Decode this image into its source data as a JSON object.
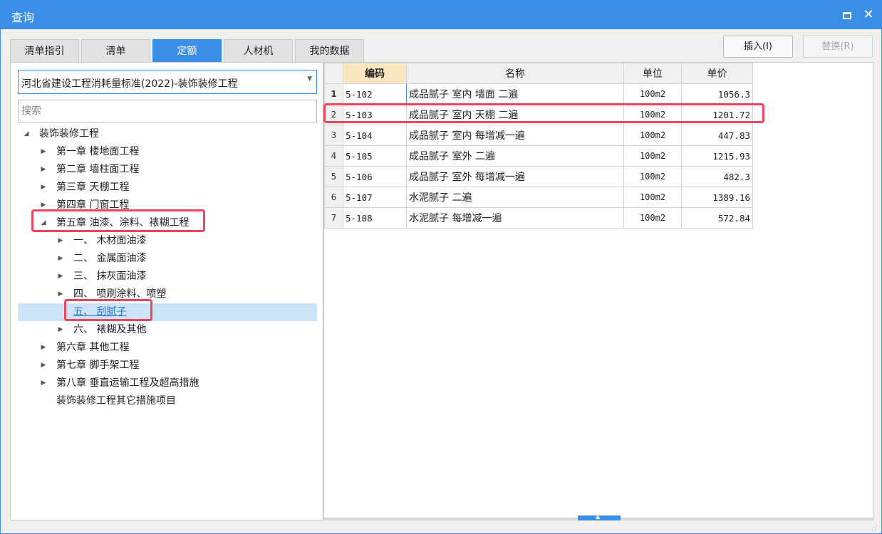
{
  "window": {
    "title": "查询",
    "maximize_label": "",
    "close_label": "✕"
  },
  "tabs": [
    {
      "label": "清单指引"
    },
    {
      "label": "清单"
    },
    {
      "label": "定额"
    },
    {
      "label": "人材机"
    },
    {
      "label": "我的数据"
    }
  ],
  "active_tab": "定额",
  "buttons": {
    "insert_label": "插入(I)",
    "replace_label": "替换(R)"
  },
  "library_select": {
    "value": "河北省建设工程消耗量标准(2022)-装饰装修工程"
  },
  "search": {
    "placeholder": "搜索",
    "value": ""
  },
  "tree": [
    {
      "label": "装饰装修工程",
      "toggle": "◢"
    },
    {
      "label": "第一章 楼地面工程",
      "toggle": "▶"
    },
    {
      "label": "第二章 墙柱面工程",
      "toggle": "▶"
    },
    {
      "label": "第三章 天棚工程",
      "toggle": "▶"
    },
    {
      "label": "第四章 门窗工程",
      "toggle": "▶"
    },
    {
      "label": "第五章 油漆、涂料、裱糊工程",
      "toggle": "◢"
    },
    {
      "label": "一、 木材面油漆",
      "toggle": "▶"
    },
    {
      "label": "二、 金属面油漆",
      "toggle": "▶"
    },
    {
      "label": "三、 抹灰面油漆",
      "toggle": "▶"
    },
    {
      "label": "四、 喷刷涂料、喷塑",
      "toggle": "▶"
    },
    {
      "label": "五、 刮腻子",
      "toggle": ""
    },
    {
      "label": "六、 裱糊及其他",
      "toggle": "▶"
    },
    {
      "label": "第六章 其他工程",
      "toggle": "▶"
    },
    {
      "label": "第七章 脚手架工程",
      "toggle": "▶"
    },
    {
      "label": "第八章 垂直运输工程及超高措施",
      "toggle": "▶"
    },
    {
      "label": "装饰装修工程其它措施项目",
      "toggle": ""
    }
  ],
  "table": {
    "headers": {
      "code": "编码",
      "name": "名称",
      "unit": "单位",
      "price": "单价"
    },
    "rows": [
      {
        "no": "1",
        "code": "5-102",
        "name": "成品腻子 室内 墙面 二遍",
        "unit": "100m2",
        "price": "1056.3"
      },
      {
        "no": "2",
        "code": "5-103",
        "name": "成品腻子 室内 天棚 二遍",
        "unit": "100m2",
        "price": "1201.72"
      },
      {
        "no": "3",
        "code": "5-104",
        "name": "成品腻子 室内 每增减一遍",
        "unit": "100m2",
        "price": "447.83"
      },
      {
        "no": "4",
        "code": "5-105",
        "name": "成品腻子 室外 二遍",
        "unit": "100m2",
        "price": "1215.93"
      },
      {
        "no": "5",
        "code": "5-106",
        "name": "成品腻子 室外 每增减一遍",
        "unit": "100m2",
        "price": "482.3"
      },
      {
        "no": "6",
        "code": "5-107",
        "name": "水泥腻子 二遍",
        "unit": "100m2",
        "price": "1389.16"
      },
      {
        "no": "7",
        "code": "5-108",
        "name": "水泥腻子 每增减一遍",
        "unit": "100m2",
        "price": "572.84"
      }
    ]
  },
  "colors": {
    "accent": "#3a8ee6",
    "highlight": "#f0445a",
    "selected_row": "#cce4f7",
    "header_selected": "#fbe6c2"
  }
}
